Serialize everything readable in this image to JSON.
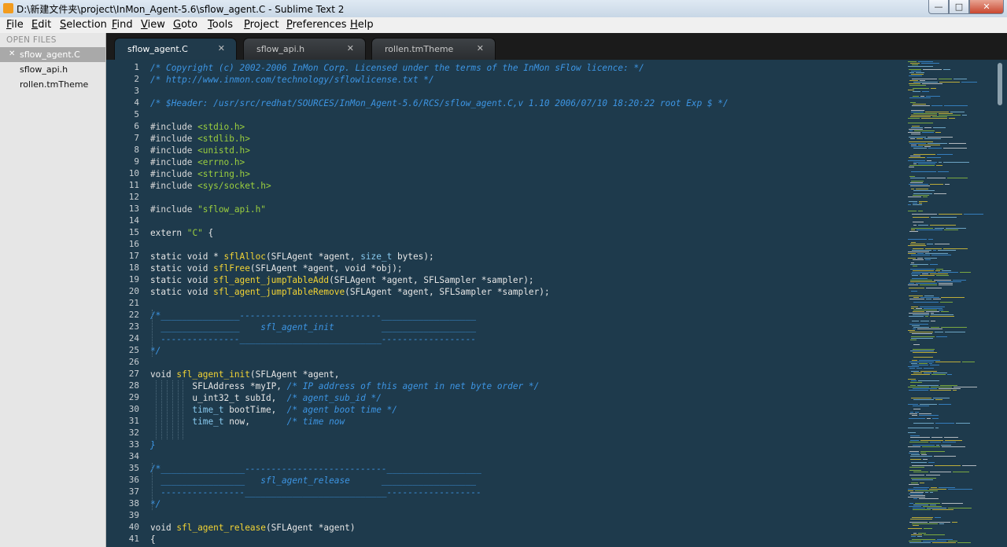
{
  "window": {
    "title": "D:\\新建文件夹\\project\\InMon_Agent-5.6\\sflow_agent.C - Sublime Text 2",
    "buttons": [
      "minimize",
      "maximize",
      "close"
    ]
  },
  "menu": [
    "File",
    "Edit",
    "Selection",
    "Find",
    "View",
    "Goto",
    "Tools",
    "Project",
    "Preferences",
    "Help"
  ],
  "sidebar": {
    "header": "OPEN FILES",
    "files": [
      {
        "name": "sflow_agent.C",
        "active": true
      },
      {
        "name": "sflow_api.h",
        "active": false
      },
      {
        "name": "rollen.tmTheme",
        "active": false
      }
    ]
  },
  "tabs": [
    {
      "label": "sflow_agent.C",
      "active": true
    },
    {
      "label": "sflow_api.h",
      "active": false
    },
    {
      "label": "rollen.tmTheme",
      "active": false
    }
  ],
  "colors": {
    "editor_bg": "#1e3a4c",
    "comment": "#3d95e3",
    "string": "#9bcf3e",
    "function": "#f3d434",
    "type": "#88c9ee"
  },
  "code_lines": [
    {
      "n": "1",
      "parts": [
        [
          "c",
          "/* Copyright (c) 2002-2006 InMon Corp. Licensed under the terms of the InMon sFlow licence: */"
        ]
      ]
    },
    {
      "n": "2",
      "parts": [
        [
          "c",
          "/* http://www.inmon.com/technology/sflowlicense.txt */"
        ]
      ]
    },
    {
      "n": "3",
      "parts": []
    },
    {
      "n": "4",
      "parts": [
        [
          "c",
          "/* $Header: /usr/src/redhat/SOURCES/InMon_Agent-5.6/RCS/sflow_agent.C,v 1.10 2006/07/10 18:20:22 root Exp $ */"
        ]
      ]
    },
    {
      "n": "5",
      "parts": []
    },
    {
      "n": "6",
      "parts": [
        [
          "p",
          "#include "
        ],
        [
          "s",
          "<stdio.h>"
        ]
      ]
    },
    {
      "n": "7",
      "parts": [
        [
          "p",
          "#include "
        ],
        [
          "s",
          "<stdlib.h>"
        ]
      ]
    },
    {
      "n": "8",
      "parts": [
        [
          "p",
          "#include "
        ],
        [
          "s",
          "<unistd.h>"
        ]
      ]
    },
    {
      "n": "9",
      "parts": [
        [
          "p",
          "#include "
        ],
        [
          "s",
          "<errno.h>"
        ]
      ]
    },
    {
      "n": "10",
      "parts": [
        [
          "p",
          "#include "
        ],
        [
          "s",
          "<string.h>"
        ]
      ]
    },
    {
      "n": "11",
      "parts": [
        [
          "p",
          "#include "
        ],
        [
          "s",
          "<sys/socket.h>"
        ]
      ]
    },
    {
      "n": "12",
      "parts": []
    },
    {
      "n": "13",
      "parts": [
        [
          "p",
          "#include "
        ],
        [
          "s",
          "\"sflow_api.h\""
        ]
      ]
    },
    {
      "n": "14",
      "parts": []
    },
    {
      "n": "15",
      "parts": [
        [
          "k",
          "extern "
        ],
        [
          "s",
          "\"C\""
        ],
        [
          "k",
          " {"
        ]
      ]
    },
    {
      "n": "16",
      "parts": []
    },
    {
      "n": "17",
      "parts": [
        [
          "k",
          "static void * "
        ],
        [
          "f",
          "sflAlloc"
        ],
        [
          "k",
          "(SFLAgent *agent, "
        ],
        [
          "t",
          "size_t"
        ],
        [
          "k",
          " bytes);"
        ]
      ]
    },
    {
      "n": "18",
      "parts": [
        [
          "k",
          "static void "
        ],
        [
          "f",
          "sflFree"
        ],
        [
          "k",
          "(SFLAgent *agent, void *obj);"
        ]
      ]
    },
    {
      "n": "19",
      "parts": [
        [
          "k",
          "static void "
        ],
        [
          "f",
          "sfl_agent_jumpTableAdd"
        ],
        [
          "k",
          "(SFLAgent *agent, SFLSampler *sampler);"
        ]
      ]
    },
    {
      "n": "20",
      "parts": [
        [
          "k",
          "static void "
        ],
        [
          "f",
          "sfl_agent_jumpTableRemove"
        ],
        [
          "k",
          "(SFLAgent *agent, SFLSampler *sampler);"
        ]
      ]
    },
    {
      "n": "21",
      "parts": []
    },
    {
      "n": "22",
      "parts": [
        [
          "c",
          "/*_______________---------------------------__________________"
        ]
      ]
    },
    {
      "n": "23",
      "parts": [
        [
          "c",
          "  _______________    sfl_agent_init         __________________"
        ]
      ]
    },
    {
      "n": "24",
      "parts": [
        [
          "c",
          "  ---------------___________________________------------------"
        ]
      ]
    },
    {
      "n": "25",
      "parts": [
        [
          "c",
          "*/"
        ]
      ]
    },
    {
      "n": "26",
      "parts": []
    },
    {
      "n": "27",
      "parts": [
        [
          "k",
          "void "
        ],
        [
          "f",
          "sfl_agent_init"
        ],
        [
          "k",
          "(SFLAgent *agent,"
        ]
      ]
    },
    {
      "n": "28",
      "parts": [
        [
          "k",
          "        SFLAddress *myIP, "
        ],
        [
          "c",
          "/* IP address of this agent in net byte order */"
        ]
      ]
    },
    {
      "n": "29",
      "parts": [
        [
          "k",
          "        u_int32_t subId,  "
        ],
        [
          "c",
          "/* agent_sub_id */"
        ]
      ]
    },
    {
      "n": "30",
      "parts": [
        [
          "t",
          "        time_t"
        ],
        [
          "k",
          " bootTime,  "
        ],
        [
          "c",
          "/* agent boot time */"
        ]
      ]
    },
    {
      "n": "31",
      "parts": [
        [
          "t",
          "        time_t"
        ],
        [
          "k",
          " now,       "
        ],
        [
          "c",
          "/* time now"
        ]
      ]
    },
    {
      "n": "32",
      "parts": []
    },
    {
      "n": "33",
      "parts": [
        [
          "c",
          "}"
        ]
      ]
    },
    {
      "n": "34",
      "parts": []
    },
    {
      "n": "35",
      "parts": [
        [
          "c",
          "/*________________---------------------------__________________"
        ]
      ]
    },
    {
      "n": "36",
      "parts": [
        [
          "c",
          "  ________________   sfl_agent_release      __________________"
        ]
      ]
    },
    {
      "n": "37",
      "parts": [
        [
          "c",
          "  ----------------___________________________------------------"
        ]
      ]
    },
    {
      "n": "38",
      "parts": [
        [
          "c",
          "*/"
        ]
      ]
    },
    {
      "n": "39",
      "parts": []
    },
    {
      "n": "40",
      "parts": [
        [
          "k",
          "void "
        ],
        [
          "f",
          "sfl_agent_release"
        ],
        [
          "k",
          "(SFLAgent *agent)"
        ]
      ]
    },
    {
      "n": "41",
      "parts": [
        [
          "k",
          "{"
        ]
      ]
    }
  ]
}
